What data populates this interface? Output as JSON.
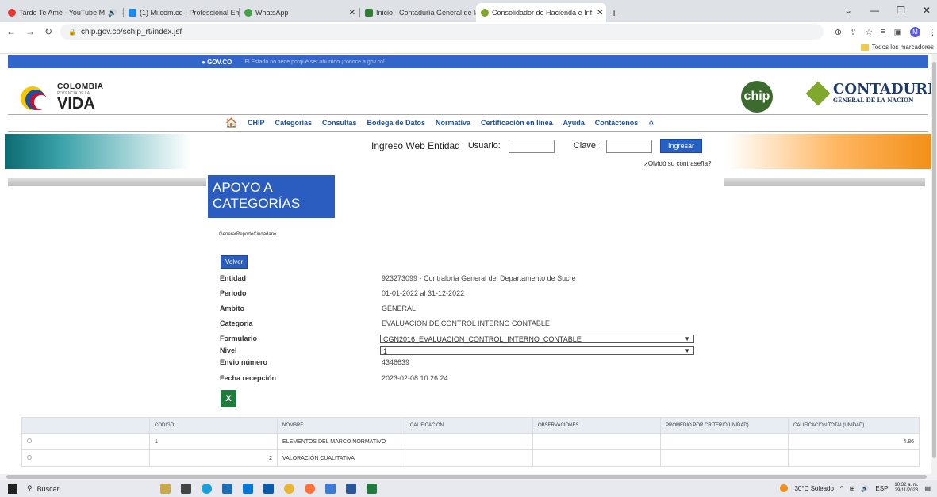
{
  "browser": {
    "tabs": [
      {
        "label": "Tarde Te Amé - YouTube M",
        "color": "#e53935"
      },
      {
        "label": "(1) Mi.com.co - Professional Em",
        "color": "#1e88e5"
      },
      {
        "label": "WhatsApp",
        "color": "#43a047"
      },
      {
        "label": "Inicio - Contaduría General de la",
        "color": "#2e7d32"
      },
      {
        "label": "Consolidador de Hacienda e Inf",
        "color": "#7fa82d"
      }
    ],
    "url": "chip.gov.co/schip_rt/index.jsf",
    "bookmarks_label": "Todos los marcadores",
    "avatar_letter": "M"
  },
  "gov_bar": {
    "logo": "GOV.CO",
    "text": "El Estado no tiene porqué ser aburrido ¡conoce a gov.co!"
  },
  "header": {
    "colombia_l1": "COLOMBIA",
    "colombia_l2": "POTENCIA DE LA",
    "colombia_l3": "VIDA",
    "chip_logo": "chip",
    "cgn_t1": "CONTADURÍA",
    "cgn_t2": "GENERAL DE LA NACIÓN"
  },
  "menu": [
    "CHIP",
    "Categorias",
    "Consultas",
    "Bodega de Datos",
    "Normativa",
    "Certificación en línea",
    "Ayuda",
    "Contáctenos"
  ],
  "login": {
    "title": "Ingreso Web Entidad",
    "user_label": "Usuario:",
    "pass_label": "Clave:",
    "button": "Ingresar",
    "forgot": "¿Olvidó su contraseña?"
  },
  "main": {
    "title_line1": "APOYO A",
    "title_line2": "CATEGORÍAS",
    "report_id": "GenerarReporteCiudadano",
    "back_button": "Volver",
    "fields": {
      "entidad_label": "Entidad",
      "entidad_value": "923273099 - Contraloría General del Departamento de Sucre",
      "periodo_label": "Periodo",
      "periodo_value": "01-01-2022 al 31-12-2022",
      "ambito_label": "Ambito",
      "ambito_value": "GENERAL",
      "categoria_label": "Categoria",
      "categoria_value": "EVALUACION DE CONTROL INTERNO CONTABLE",
      "formulario_label": "Formulario",
      "formulario_value": "CGN2016_EVALUACION_CONTROL_INTERNO_CONTABLE",
      "nivel_label": "Nivel",
      "nivel_value": "1",
      "envio_label": "Envio número",
      "envio_value": "4346639",
      "fecha_label": "Fecha recepción",
      "fecha_value": "2023-02-08 10:26:24"
    },
    "table": {
      "headers": [
        "",
        "CODIGO",
        "NOMBRE",
        "CALIFICACION",
        "OBSERVACIONES",
        "PROMEDIO POR CRITERIO(Unidad)",
        "CALIFICACION TOTAL(Unidad)"
      ],
      "rows": [
        {
          "codigo": "1",
          "nombre": "ELEMENTOS DEL MARCO NORMATIVO",
          "calificacion": "",
          "observaciones": "",
          "promedio": "",
          "total": "4.86"
        },
        {
          "codigo": "2",
          "nombre": "VALORACIÓN CUALITATIVA",
          "calificacion": "",
          "observaciones": "",
          "promedio": "",
          "total": ""
        }
      ]
    }
  },
  "taskbar": {
    "search": "Buscar",
    "weather": "30°C Soleado",
    "lang": "ESP",
    "time": "10:32 a. m.",
    "date": "29/11/2023"
  }
}
